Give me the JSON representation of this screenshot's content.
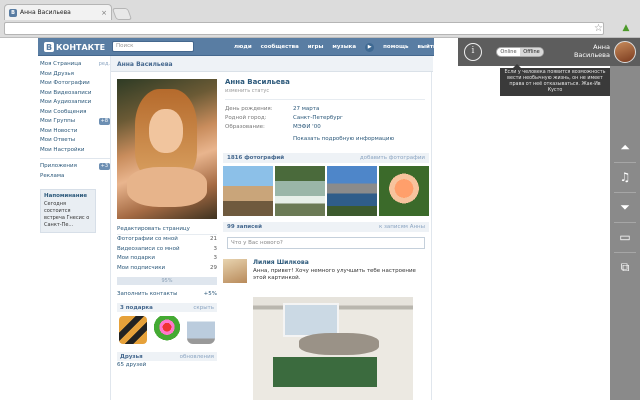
{
  "browser": {
    "tab_title": "Анна Васильева",
    "tab_favicon": "В",
    "tab_close": "×",
    "star_icon": "☆",
    "ext_icon": "▲"
  },
  "vk": {
    "logo_mark": "В",
    "logo_text": "КОНТАКТЕ",
    "search_placeholder": "Поиск",
    "nav": [
      "люди",
      "сообщества",
      "игры",
      "музыка",
      "помощь",
      "выйти"
    ],
    "play_icon": "▶",
    "left_menu": [
      {
        "label": "Моя Страница",
        "extra": "ред."
      },
      {
        "label": "Мои Друзья",
        "extra": ""
      },
      {
        "label": "Мои Фотографии",
        "extra": ""
      },
      {
        "label": "Мои Видеозаписи",
        "extra": ""
      },
      {
        "label": "Мои Аудиозаписи",
        "extra": ""
      },
      {
        "label": "Мои Сообщения",
        "extra": ""
      },
      {
        "label": "Мои Группы",
        "extra": "+8"
      },
      {
        "label": "Мои Новости",
        "extra": ""
      },
      {
        "label": "Мои Ответы",
        "extra": ""
      },
      {
        "label": "Мои Настройки",
        "extra": ""
      }
    ],
    "left_menu_apps": [
      {
        "label": "Приложения",
        "extra": "+3"
      },
      {
        "label": "Реклама",
        "extra": ""
      }
    ],
    "reminder": {
      "title": "Напоминание",
      "body": "Сегодня состоится встреча Гнесис о Санкт-Пе..."
    },
    "page_title": "Анна Васильева",
    "profile": {
      "name": "Анна Васильева",
      "status": "изменить статус",
      "info": [
        {
          "key": "День рождения:",
          "value": "27 марта"
        },
        {
          "key": "Родной город:",
          "value": "Санкт-Петербург"
        },
        {
          "key": "Образование:",
          "value": "МЭФИ '00"
        }
      ],
      "more": "Показать подробную информацию"
    },
    "edit_page": "Редактировать страницу",
    "counters": [
      {
        "label": "Фотографии со мной",
        "n": "21"
      },
      {
        "label": "Видеозаписи со мной",
        "n": "3"
      },
      {
        "label": "Мои подарки",
        "n": "3"
      },
      {
        "label": "Мои подписчики",
        "n": "29"
      }
    ],
    "progress": "95%",
    "progress_value": 0.95,
    "fill_contacts": {
      "label": "Заполнить контакты",
      "value": "+5%"
    },
    "gifts": {
      "title": "3 подарка",
      "action": "скрыть"
    },
    "friends": {
      "title": "Друзья",
      "action": "обновления",
      "count": "65 друзей"
    },
    "photos": {
      "title": "1816 фотографий",
      "action": "добавить фотографии"
    },
    "wall": {
      "title": "99 записей",
      "action": "к записям Анны",
      "input_placeholder": "Что у Вас нового?",
      "post": {
        "author": "Лилия Шилкова",
        "text": "Анна, привет! Хочу немного улучшить тебе настроение этой картинкой."
      }
    }
  },
  "extension": {
    "info_icon": "i",
    "toggle": [
      "Online",
      "Offline"
    ],
    "toggle_selected": "Offline",
    "user_name": "Анна Васильева",
    "tooltip": "Если у человека появится возможность вести необычную жизнь, он не имеет права от неё отказываться. Жак-Ив Кусто",
    "sidebar_icons": [
      "arrow-up-icon",
      "music-note-icon",
      "arrow-down-icon",
      "folder-icon",
      "copy-add-icon"
    ],
    "sidebar_glyphs": [
      "⏶",
      "♫",
      "⏷",
      "▭",
      "⧉"
    ]
  }
}
